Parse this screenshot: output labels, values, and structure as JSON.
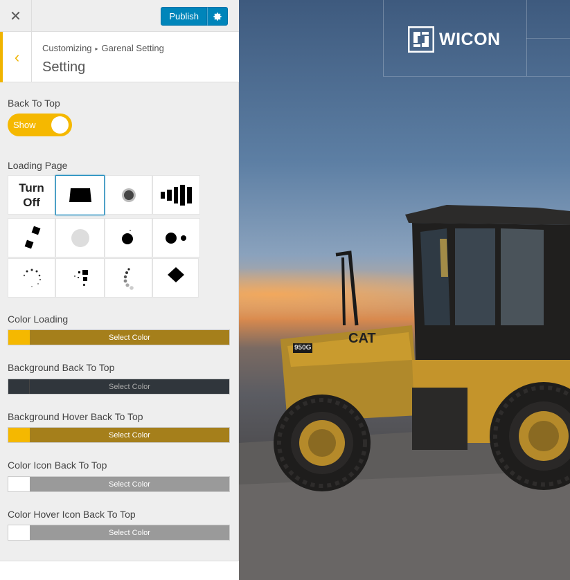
{
  "topbar": {
    "close_icon": "close-icon",
    "publish_label": "Publish",
    "settings_icon": "gear-icon"
  },
  "section": {
    "back_icon": "chevron-left-icon",
    "breadcrumb": {
      "parent": "Customizing",
      "current": "Garenal Setting"
    },
    "title": "Setting"
  },
  "back_to_top": {
    "label": "Back To Top",
    "toggle_text": "Show",
    "toggle_on": true,
    "accent": "#f5b800"
  },
  "loading_page": {
    "label": "Loading Page",
    "turn_off_line1": "Turn",
    "turn_off_line2": "Off",
    "selected_index": 1
  },
  "colors": [
    {
      "label": "Color Loading",
      "button": "Select Color",
      "swatch": "#f5b800",
      "bar": "#a57f1b"
    },
    {
      "label": "Background Back To Top",
      "button": "Select Color",
      "swatch": "#30363c",
      "bar": "#30363c"
    },
    {
      "label": "Background Hover Back To Top",
      "button": "Select Color",
      "swatch": "#f5b800",
      "bar": "#a57f1b"
    },
    {
      "label": "Color Icon Back To Top",
      "button": "Select Color",
      "swatch": "#ffffff",
      "bar": "#9a9a9a"
    },
    {
      "label": "Color Hover Icon Back To Top",
      "button": "Select Color",
      "swatch": "#ffffff",
      "bar": "#9a9a9a"
    }
  ],
  "preview": {
    "logo_text": "WICON",
    "logo_icon": "wicon-logo-icon",
    "vehicle_badge": "950G",
    "vehicle_brand": "CAT"
  }
}
